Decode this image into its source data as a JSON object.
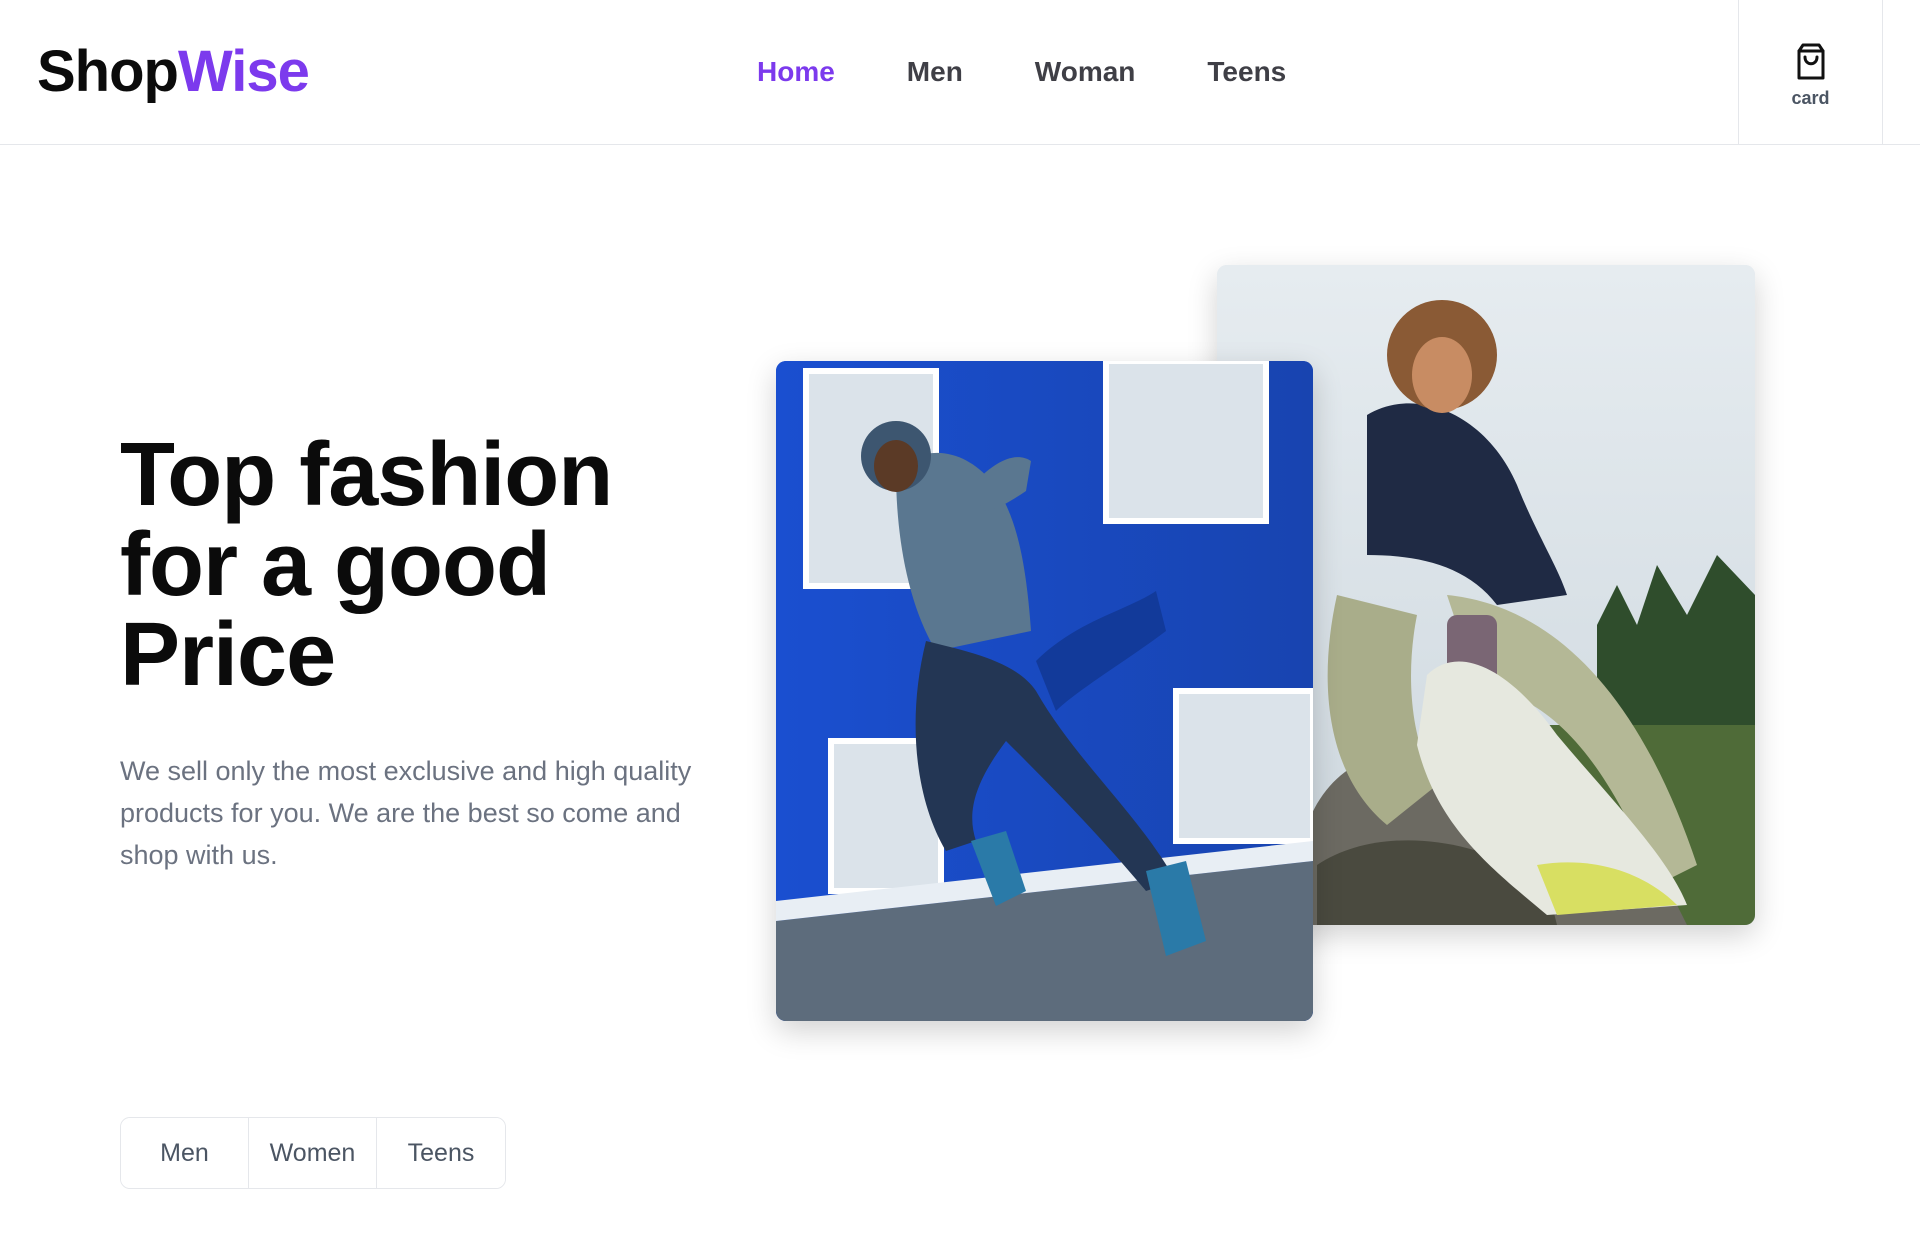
{
  "header": {
    "logo_part1": "Shop",
    "logo_part2": "Wise",
    "nav": [
      "Home",
      "Men",
      "Woman",
      "Teens"
    ],
    "active_nav": "Home",
    "cart_label": "card",
    "cart_icon": "shopping-bag-icon"
  },
  "hero": {
    "title_lines": [
      "Top fashion",
      "for a good",
      "Price"
    ],
    "description": "We sell only the most exclusive and high quality products for you. We are the best so come and shop with us."
  },
  "category_tabs": [
    "Men",
    "Women",
    "Teens"
  ],
  "colors": {
    "accent": "#7c3aed",
    "text": "#0b0b0b",
    "muted": "#6b7280",
    "border": "#e5e7eb"
  }
}
